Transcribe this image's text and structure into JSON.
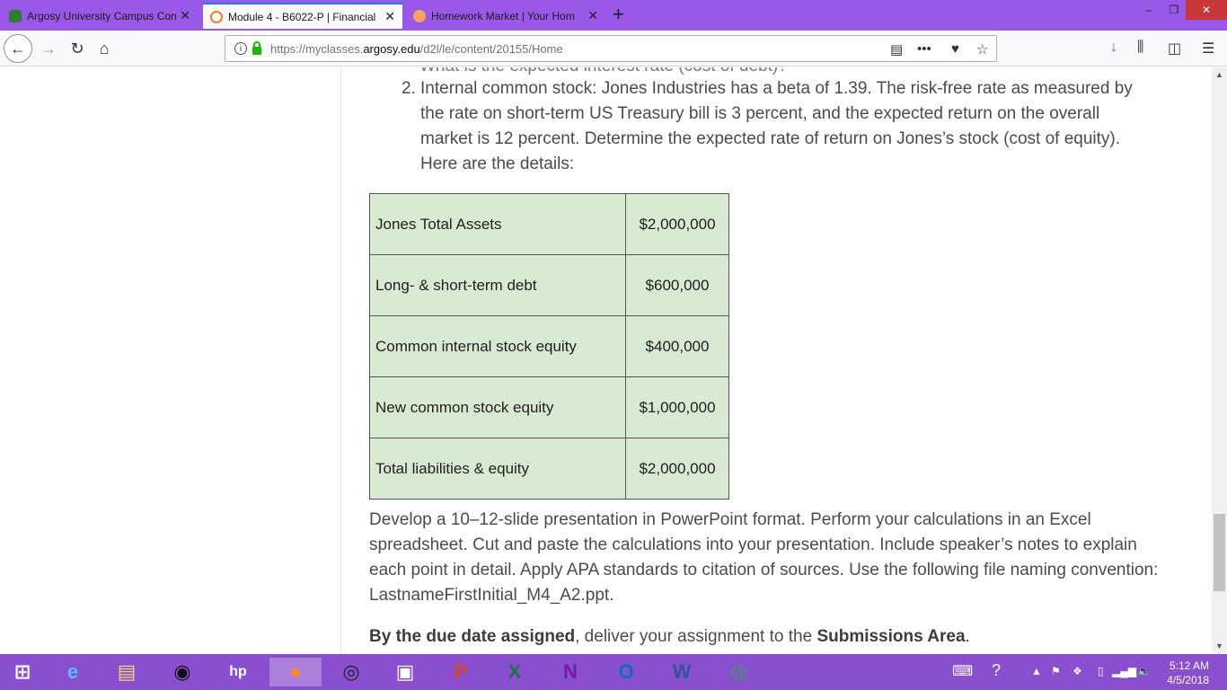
{
  "browser": {
    "tabs": [
      {
        "title": "Argosy University Campus Con",
        "favicon_color": "#2e7d32"
      },
      {
        "title": "Module 4 - B6022-P | Financial",
        "favicon_color": "#e8822a"
      },
      {
        "title": "Homework Market | Your Hom",
        "favicon_color": "#f5a25d"
      }
    ],
    "new_tab": "+",
    "window_controls": {
      "minimize": "–",
      "restore": "❐",
      "close": "✕"
    },
    "url_prefix": "https://myclasses.",
    "url_domain": "argosy.edu",
    "url_path": "/d2l/le/content/20155/Home",
    "menu_icon": "hamburger-icon"
  },
  "content": {
    "cut_line": "What is the expected interest rate (cost of debt)?",
    "item_number": "2.",
    "item_text": "Internal common stock: Jones Industries has a beta of 1.39. The risk-free rate as measured by the rate on short-term US Treasury bill is 3 percent, and the expected return on the overall market is 12 percent. Determine the expected rate of return on Jones’s stock (cost of equity). Here are the details:",
    "table": [
      {
        "label": "Jones Total Assets",
        "value": "$2,000,000"
      },
      {
        "label": "Long- & short-term debt",
        "value": "$600,000"
      },
      {
        "label": "Common internal stock equity",
        "value": "$400,000"
      },
      {
        "label": "New common stock equity",
        "value": "$1,000,000"
      },
      {
        "label": "Total liabilities & equity",
        "value": "$2,000,000"
      }
    ],
    "paragraph": "Develop a 10–12-slide presentation in PowerPoint format. Perform your calculations in an Excel spreadsheet. Cut and paste the calculations into your presentation. Include speaker’s notes to explain each point in detail. Apply APA standards to citation of sources. Use the following file naming convention: LastnameFirstInitial_M4_A2.ppt.",
    "due_bold": "By the due date assigned",
    "due_mid": ", deliver your assignment to the ",
    "due_area": "Submissions Area",
    "due_end": "."
  },
  "taskbar": {
    "apps": [
      {
        "name": "windows-start",
        "glyph": "⊞",
        "color": "#ffffff"
      },
      {
        "name": "internet-explorer",
        "glyph": "e",
        "color": "#4fc3f7"
      },
      {
        "name": "file-explorer",
        "glyph": "▤",
        "color": "#f6d36b"
      },
      {
        "name": "app-circle",
        "glyph": "◉",
        "color": "#111111"
      },
      {
        "name": "hp",
        "glyph": "hp",
        "color": "#ffffff"
      },
      {
        "name": "firefox",
        "glyph": "●",
        "color": "#ff8a1e"
      },
      {
        "name": "media-player",
        "glyph": "◎",
        "color": "#222222"
      },
      {
        "name": "video-app",
        "glyph": "▣",
        "color": "#ffffff"
      },
      {
        "name": "powerpoint",
        "glyph": "P",
        "color": "#d24726"
      },
      {
        "name": "excel",
        "glyph": "X",
        "color": "#1d7145"
      },
      {
        "name": "onenote",
        "glyph": "N",
        "color": "#7719aa"
      },
      {
        "name": "outlook",
        "glyph": "O",
        "color": "#0072c6"
      },
      {
        "name": "word",
        "glyph": "W",
        "color": "#2b579a"
      },
      {
        "name": "chrome",
        "glyph": "◎",
        "color": "#34a853"
      }
    ],
    "time": "5:12 AM",
    "date": "4/5/2018"
  }
}
